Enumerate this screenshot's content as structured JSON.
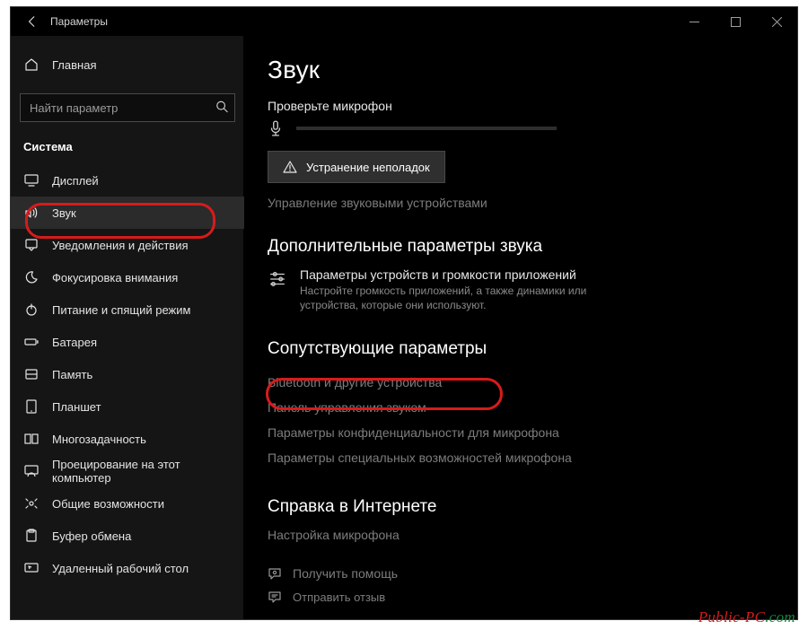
{
  "titlebar": {
    "title": "Параметры"
  },
  "sidebar": {
    "home": "Главная",
    "search_placeholder": "Найти параметр",
    "section": "Система",
    "items": [
      {
        "label": "Дисплей",
        "icon": "display-icon"
      },
      {
        "label": "Звук",
        "icon": "sound-icon",
        "selected": true
      },
      {
        "label": "Уведомления и действия",
        "icon": "notifications-icon"
      },
      {
        "label": "Фокусировка внимания",
        "icon": "focus-assist-icon"
      },
      {
        "label": "Питание и спящий режим",
        "icon": "power-icon"
      },
      {
        "label": "Батарея",
        "icon": "battery-icon"
      },
      {
        "label": "Память",
        "icon": "storage-icon"
      },
      {
        "label": "Планшет",
        "icon": "tablet-icon"
      },
      {
        "label": "Многозадачность",
        "icon": "multitasking-icon"
      },
      {
        "label": "Проецирование на этот компьютер",
        "icon": "projecting-icon"
      },
      {
        "label": "Общие возможности",
        "icon": "shared-experiences-icon"
      },
      {
        "label": "Буфер обмена",
        "icon": "clipboard-icon"
      },
      {
        "label": "Удаленный рабочий стол",
        "icon": "remote-desktop-icon"
      }
    ]
  },
  "page": {
    "title": "Звук",
    "mic_check": "Проверьте микрофон",
    "troubleshoot": "Устранение неполадок",
    "manage_devices": "Управление звуковыми устройствами",
    "advanced_heading": "Дополнительные параметры звука",
    "app_volume_title": "Параметры устройств и громкости приложений",
    "app_volume_desc": "Настройте громкость приложений, а также динамики или устройства, которые они используют.",
    "related_heading": "Сопутствующие параметры",
    "related": [
      "Bluetooth и другие устройства",
      "Панель управления звуком",
      "Параметры конфиденциальности для микрофона",
      "Параметры специальных возможностей микрофона"
    ],
    "web_help_heading": "Справка в Интернете",
    "web_help_item": "Настройка микрофона",
    "get_help": "Получить помощь",
    "feedback": "Отправить отзыв"
  },
  "watermark": {
    "a": "Public-PC",
    "b": ".com"
  }
}
